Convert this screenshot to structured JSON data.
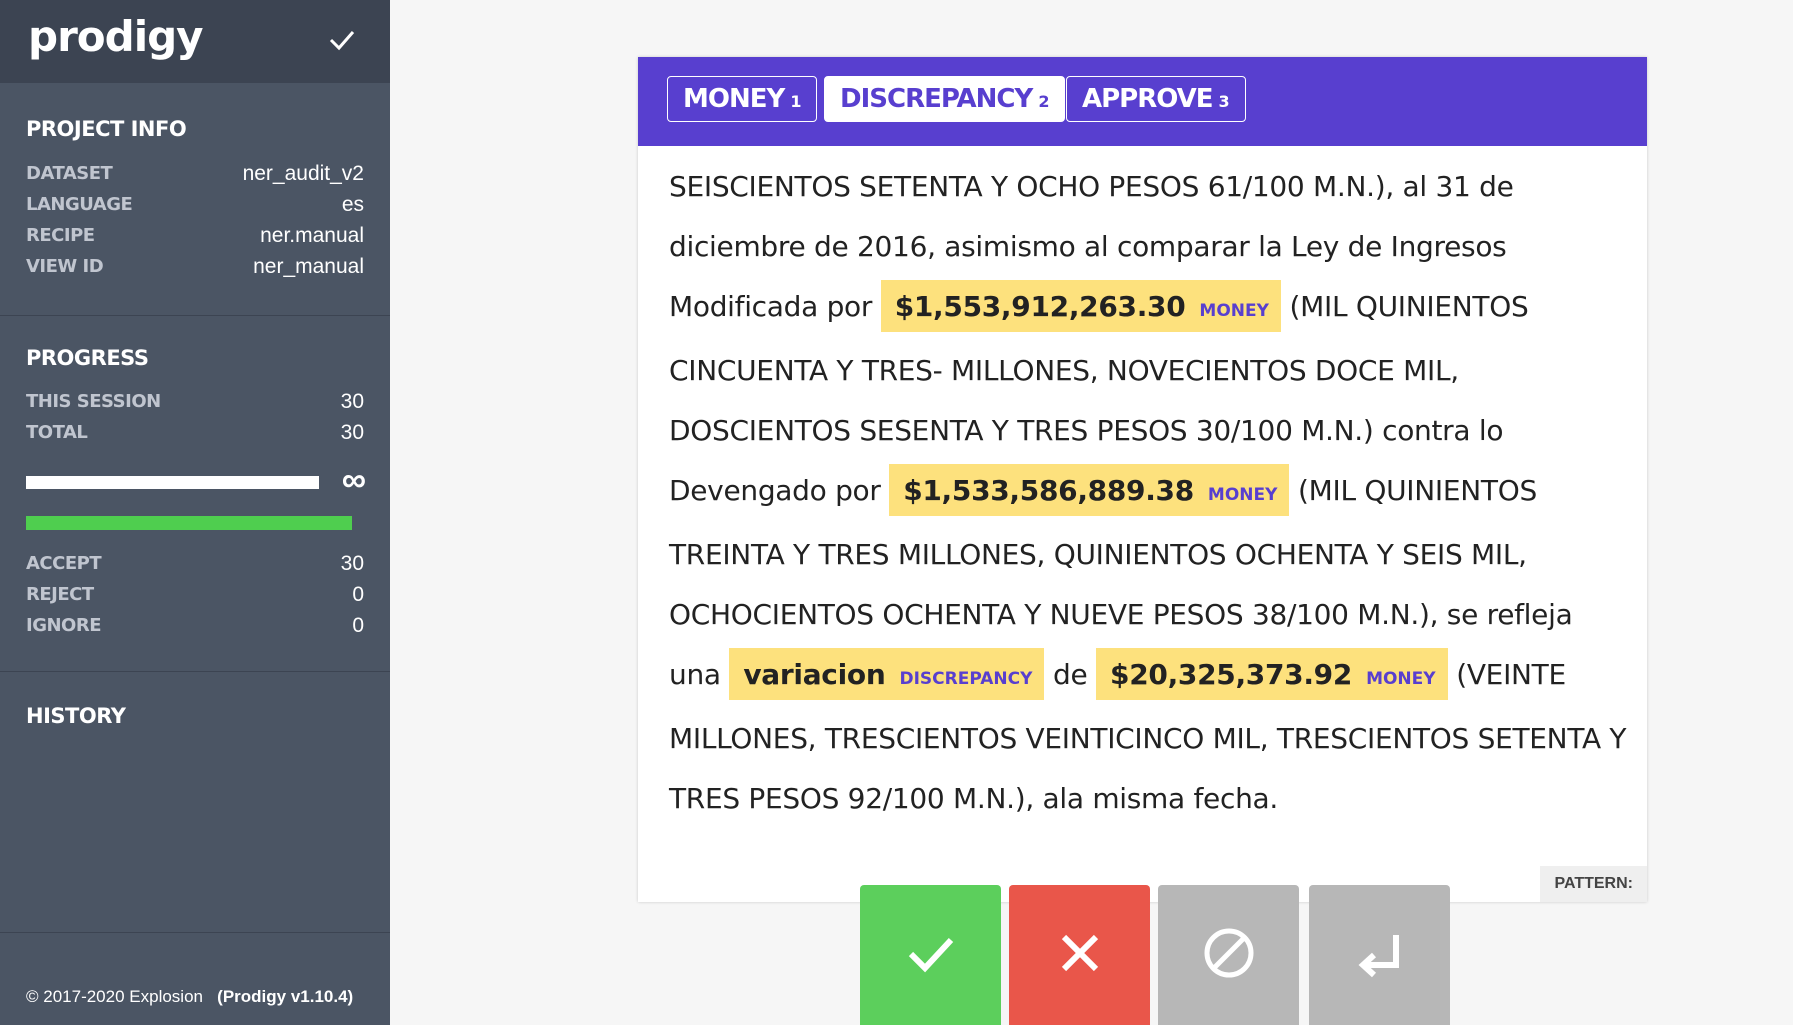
{
  "app": {
    "logo": "prodigy"
  },
  "sidebar": {
    "project_info": {
      "title": "PROJECT INFO",
      "rows": [
        {
          "key": "DATASET",
          "value": "ner_audit_v2"
        },
        {
          "key": "LANGUAGE",
          "value": "es"
        },
        {
          "key": "RECIPE",
          "value": "ner.manual"
        },
        {
          "key": "VIEW ID",
          "value": "ner_manual"
        }
      ]
    },
    "progress": {
      "title": "PROGRESS",
      "session": {
        "key": "THIS SESSION",
        "value": "30"
      },
      "total": {
        "key": "TOTAL",
        "value": "30"
      },
      "infinity": "∞",
      "accept": {
        "key": "ACCEPT",
        "value": "30"
      },
      "reject": {
        "key": "REJECT",
        "value": "0"
      },
      "ignore": {
        "key": "IGNORE",
        "value": "0"
      }
    },
    "history": {
      "title": "HISTORY"
    },
    "footer": {
      "copyright": "© 2017-2020 Explosion",
      "version": "(Prodigy v1.10.4)"
    }
  },
  "labels": [
    {
      "name": "MONEY",
      "num": "1",
      "active": false
    },
    {
      "name": "DISCREPANCY",
      "num": "2",
      "active": true
    },
    {
      "name": "APPROVE",
      "num": "3",
      "active": false
    }
  ],
  "text": {
    "t1": "SEISCIENTOS SETENTA Y OCHO PESOS 61/100 M.N.), al 31 de diciembre de 2016, asimismo al comparar la Ley de Ingresos Modificada por ",
    "e1": {
      "text": "$1,553,912,263.30",
      "label": "MONEY"
    },
    "t2": " (MIL QUINIENTOS CINCUENTA Y TRES- MILLONES, NOVECIENTOS DOCE MIL, DOSCIENTOS SESENTA Y TRES PESOS 30/100 M.N.) contra lo Devengado por ",
    "e2": {
      "text": "$1,533,586,889.38",
      "label": "MONEY"
    },
    "t3": " (MIL QUINIENTOS TREINTA Y TRES MILLONES, QUINIENTOS OCHENTA Y SEIS MIL, OCHOCIENTOS OCHENTA Y NUEVE PESOS 38/100 M.N.), se refleja una ",
    "e3": {
      "text": "variacion",
      "label": "DISCREPANCY"
    },
    "t4": " de ",
    "e4": {
      "text": "$20,325,373.92",
      "label": "MONEY"
    },
    "t5": " (VEINTE MILLONES, TRESCIENTOS VEINTICINCO MIL, TRESCIENTOS SETENTA Y TRES PESOS 92/100 M.N.), ala misma fecha."
  },
  "pattern": "PATTERN:",
  "actions": [
    {
      "name": "accept",
      "icon": "check-icon",
      "color": "#5ccf5c"
    },
    {
      "name": "reject",
      "icon": "x-icon",
      "color": "#e9564a"
    },
    {
      "name": "ignore",
      "icon": "ignore-icon",
      "color": "#b7b7b7"
    },
    {
      "name": "undo",
      "icon": "undo-icon",
      "color": "#b7b7b7"
    }
  ],
  "colors": {
    "accent": "#583fcf",
    "sidebar": "#4b5564",
    "entity": "#fde17d"
  }
}
